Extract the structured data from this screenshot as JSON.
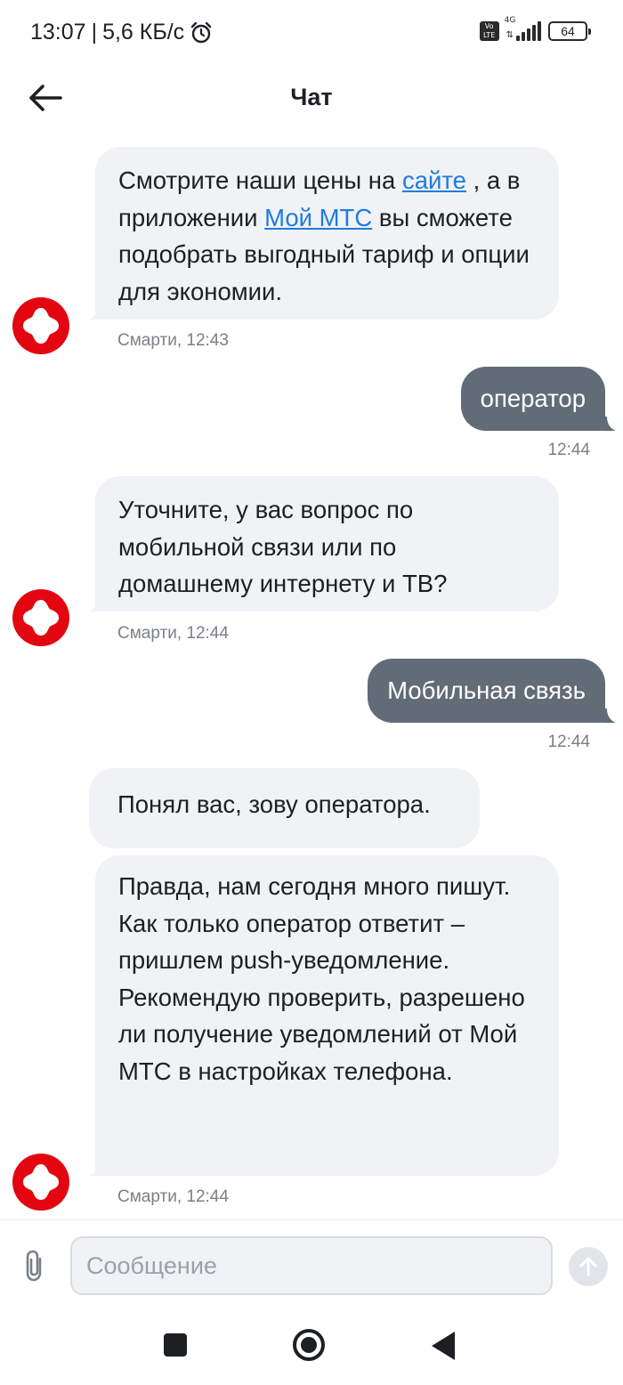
{
  "status_bar": {
    "time": "13:07",
    "separator": "|",
    "speed": "5,6 КБ/с",
    "volte": "Vo LTE",
    "network": "4G",
    "battery": "64"
  },
  "header": {
    "title": "Чат"
  },
  "messages": [
    {
      "from": "bot",
      "parts": [
        "Смотрите наши цены на ",
        "сайте",
        " , а в приложении ",
        "Мой МТС",
        " вы сможете подобрать выгодный тариф и опции для экономии."
      ],
      "meta": "Смарти, 12:43"
    },
    {
      "from": "user",
      "text": "оператор",
      "meta": "12:44"
    },
    {
      "from": "bot",
      "text": "Уточните, у вас вопрос по мобильной связи или по домашнему интернету и ТВ?",
      "meta": "Смарти, 12:44"
    },
    {
      "from": "user",
      "text": "Мобильная связь",
      "meta": "12:44"
    },
    {
      "from": "bot",
      "text": "Понял вас, зову оператора."
    },
    {
      "from": "bot",
      "lines": [
        "Правда, нам сегодня много пишут.",
        "Как только оператор ответит – пришлем push-уведомление.",
        "Рекомендую проверить, разрешено ли получение уведомлений от Мой МТС в настройках телефона."
      ],
      "meta": "Смарти, 12:44"
    }
  ],
  "input": {
    "placeholder": "Сообщение",
    "value": ""
  },
  "colors": {
    "brand_red": "#e30611",
    "user_bubble": "#626c77",
    "bot_bubble": "#f1f2f6",
    "link": "#1e7be0"
  },
  "icons": {
    "back": "arrow-left-icon",
    "attach": "paperclip-icon",
    "send": "arrow-up-icon",
    "avatar": "mts-egg-logo-icon",
    "alarm": "alarm-clock-icon"
  }
}
